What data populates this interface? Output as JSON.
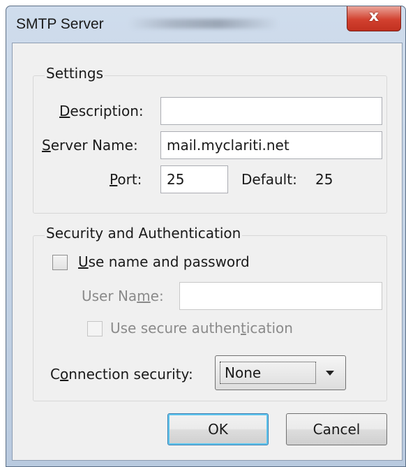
{
  "window": {
    "title": "SMTP Server",
    "close_label": "x"
  },
  "settings": {
    "group_label": "Settings",
    "description_label": "Description:",
    "description_value": "",
    "server_name_label": "Server Name:",
    "server_name_value": "mail.myclariti.net",
    "port_label": "Port:",
    "port_value": "25",
    "default_label": "Default:",
    "default_value": "25"
  },
  "security": {
    "group_label": "Security and Authentication",
    "use_name_password_label": "Use name and password",
    "use_name_password_checked": false,
    "user_name_label": "User Name:",
    "user_name_value": "",
    "secure_auth_label": "Use secure authentication",
    "secure_auth_checked": false,
    "connection_security_label": "Connection security:",
    "connection_security_value": "None"
  },
  "buttons": {
    "ok_label": "OK",
    "cancel_label": "Cancel"
  }
}
